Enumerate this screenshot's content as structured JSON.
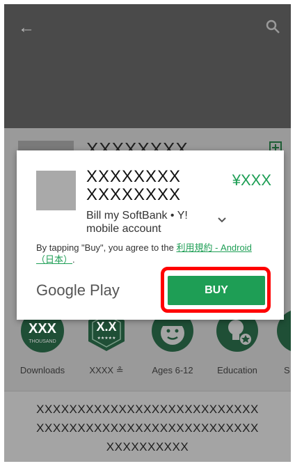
{
  "background": {
    "app_title": "XXXXXXXX",
    "stats": [
      {
        "badge": "XXX",
        "sub": "THOUSAND",
        "label": "Downloads"
      },
      {
        "badge": "X.X",
        "sub": "★★★★★",
        "label": "XXXX ≗"
      },
      {
        "badge": "",
        "sub": "",
        "label": "Ages 6-12"
      },
      {
        "badge": "",
        "sub": "",
        "label": "Education"
      },
      {
        "badge": "",
        "sub": "",
        "label": "S"
      }
    ],
    "description_lines": [
      "XXXXXXXXXXXXXXXXXXXXXXXXXXX",
      "XXXXXXXXXXXXXXXXXXXXXXXXXXX",
      "XXXXXXXXXX"
    ]
  },
  "dialog": {
    "app_name_line1": "XXXXXXXX",
    "app_name_line2": "XXXXXXXX",
    "price": "¥XXX",
    "payment_method": "Bill my SoftBank • Y! mobile account",
    "tos_prefix": "By tapping \"Buy\", you agree to the ",
    "tos_link": "利用規約 - Android（日本）",
    "tos_suffix": ".",
    "store_logo": "Google Play",
    "buy_label": "BUY"
  },
  "colors": {
    "accent": "#1e9e55",
    "highlight": "#ff0000"
  },
  "icons": [
    "back-arrow-icon",
    "search-icon",
    "wishlist-icon",
    "chevron-down-icon"
  ]
}
